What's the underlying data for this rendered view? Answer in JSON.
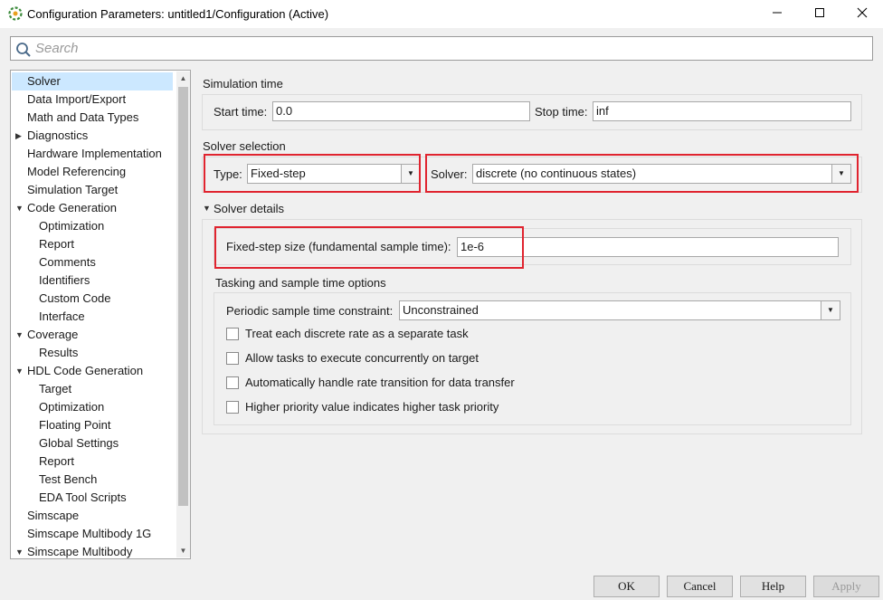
{
  "window": {
    "title": "Configuration Parameters: untitled1/Configuration (Active)"
  },
  "search": {
    "placeholder": "Search"
  },
  "tree": {
    "items": [
      {
        "label": "Solver",
        "level": 0,
        "expander": "none",
        "selected": true
      },
      {
        "label": "Data Import/Export",
        "level": 0,
        "expander": "none"
      },
      {
        "label": "Math and Data Types",
        "level": 0,
        "expander": "none"
      },
      {
        "label": "Diagnostics",
        "level": 0,
        "expander": "collapsed"
      },
      {
        "label": "Hardware Implementation",
        "level": 0,
        "expander": "none"
      },
      {
        "label": "Model Referencing",
        "level": 0,
        "expander": "none"
      },
      {
        "label": "Simulation Target",
        "level": 0,
        "expander": "none"
      },
      {
        "label": "Code Generation",
        "level": 0,
        "expander": "expanded"
      },
      {
        "label": "Optimization",
        "level": 1,
        "expander": "none"
      },
      {
        "label": "Report",
        "level": 1,
        "expander": "none"
      },
      {
        "label": "Comments",
        "level": 1,
        "expander": "none"
      },
      {
        "label": "Identifiers",
        "level": 1,
        "expander": "none"
      },
      {
        "label": "Custom Code",
        "level": 1,
        "expander": "none"
      },
      {
        "label": "Interface",
        "level": 1,
        "expander": "none"
      },
      {
        "label": "Coverage",
        "level": 0,
        "expander": "expanded"
      },
      {
        "label": "Results",
        "level": 1,
        "expander": "none"
      },
      {
        "label": "HDL Code Generation",
        "level": 0,
        "expander": "expanded"
      },
      {
        "label": "Target",
        "level": 1,
        "expander": "none"
      },
      {
        "label": "Optimization",
        "level": 1,
        "expander": "none"
      },
      {
        "label": "Floating Point",
        "level": 1,
        "expander": "none"
      },
      {
        "label": "Global Settings",
        "level": 1,
        "expander": "none"
      },
      {
        "label": "Report",
        "level": 1,
        "expander": "none"
      },
      {
        "label": "Test Bench",
        "level": 1,
        "expander": "none"
      },
      {
        "label": "EDA Tool Scripts",
        "level": 1,
        "expander": "none"
      },
      {
        "label": "Simscape",
        "level": 0,
        "expander": "none"
      },
      {
        "label": "Simscape Multibody 1G",
        "level": 0,
        "expander": "none"
      },
      {
        "label": "Simscape Multibody",
        "level": 0,
        "expander": "expanded"
      }
    ]
  },
  "simulation_time": {
    "heading": "Simulation time",
    "start_label": "Start time:",
    "start_value": "0.0",
    "stop_label": "Stop time:",
    "stop_value": "inf"
  },
  "solver_selection": {
    "heading": "Solver selection",
    "type_label": "Type:",
    "type_value": "Fixed-step",
    "solver_label": "Solver:",
    "solver_value": "discrete (no continuous states)"
  },
  "solver_details": {
    "heading": "Solver details",
    "step_label": "Fixed-step size (fundamental sample time):",
    "step_value": "1e-6"
  },
  "tasking": {
    "heading": "Tasking and sample time options",
    "constraint_label": "Periodic sample time constraint:",
    "constraint_value": "Unconstrained",
    "checkboxes": [
      {
        "label": "Treat each discrete rate as a separate task",
        "checked": false
      },
      {
        "label": "Allow tasks to execute concurrently on target",
        "checked": false
      },
      {
        "label": "Automatically handle rate transition for data transfer",
        "checked": false
      },
      {
        "label": "Higher priority value indicates higher task priority",
        "checked": false
      }
    ]
  },
  "buttons": {
    "ok": "OK",
    "cancel": "Cancel",
    "help": "Help",
    "apply": "Apply"
  },
  "colors": {
    "highlight_box": "#e0242f",
    "tree_selection": "#cce8ff"
  }
}
